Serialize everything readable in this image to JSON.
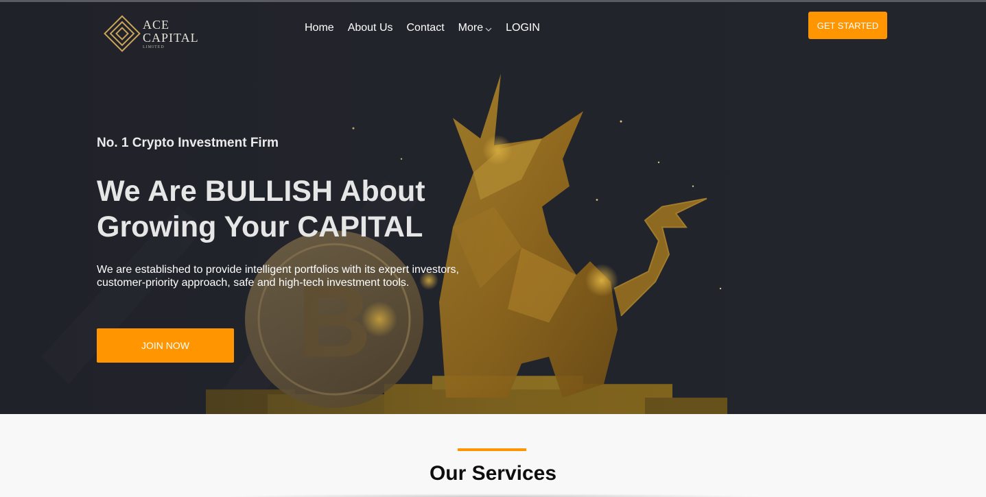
{
  "brand": {
    "line1": "ACE",
    "line2": "CAPITAL",
    "line3": "LIMITED",
    "color": "#c9a45a"
  },
  "nav": {
    "items": [
      {
        "label": "Home"
      },
      {
        "label": "About Us"
      },
      {
        "label": "Contact"
      },
      {
        "label": "More",
        "icon": "chevron-down-icon"
      },
      {
        "label": "LOGIN"
      }
    ]
  },
  "header": {
    "cta_label": "GET STARTED"
  },
  "hero": {
    "eyebrow": "No. 1 Crypto Investment Firm",
    "headline_line1": "We Are BULLISH About",
    "headline_line2": "Growing Your CAPITAL",
    "lead_line1": "We are established to provide intelligent portfolios with its expert investors,",
    "lead_line2": "customer-priority approach, safe and high-tech investment tools.",
    "cta_label": "JOIN NOW",
    "background": "golden low-poly bull with bitcoin coin"
  },
  "services": {
    "title": "Our Services"
  },
  "colors": {
    "accent": "#ff9500",
    "hero_bg": "#23252d",
    "gold": "#c9a45a"
  }
}
